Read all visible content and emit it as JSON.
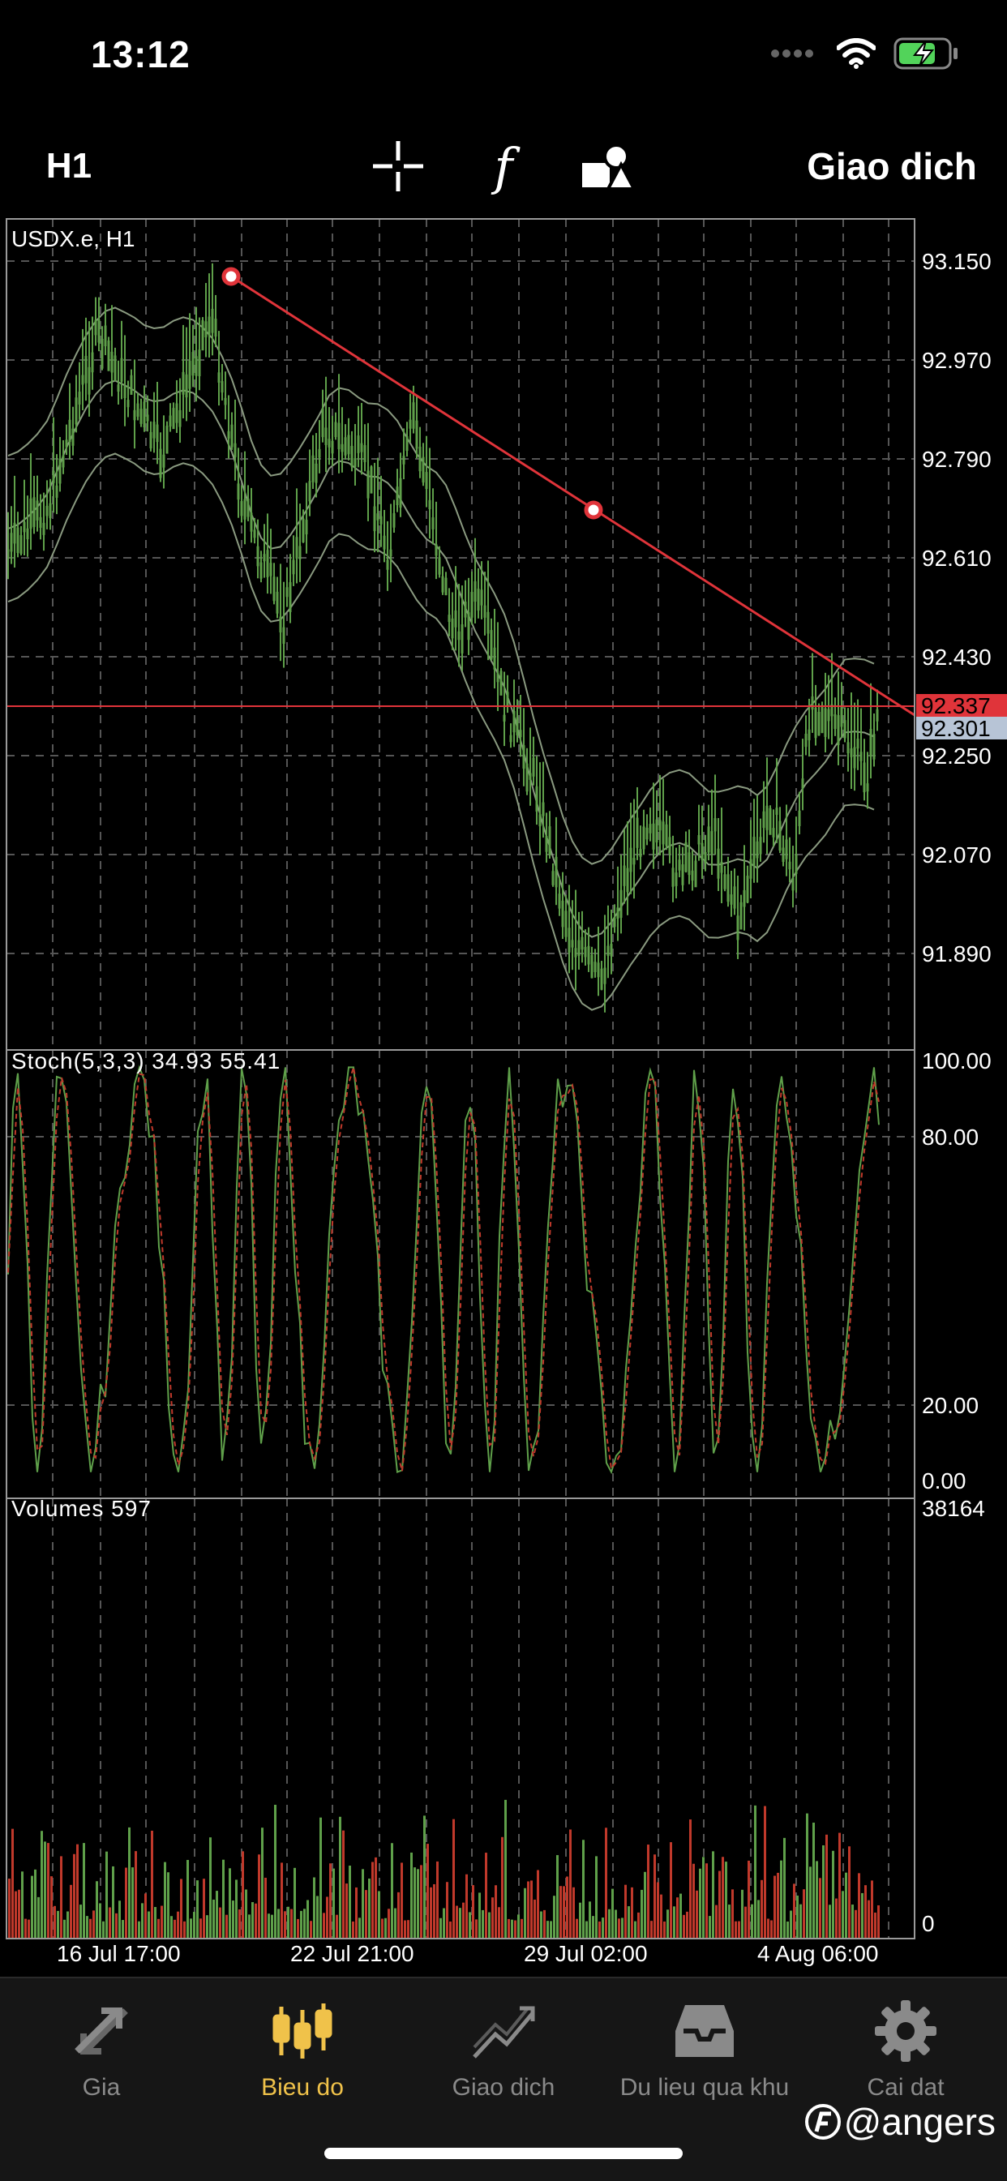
{
  "status": {
    "time": "13:12"
  },
  "toolbar": {
    "timeframe": "H1",
    "trade_label": "Giao dich",
    "function_glyph": "f"
  },
  "chart": {
    "symbol_label": "USDX.e, H1",
    "price_ticks": [
      "93.150",
      "92.970",
      "92.790",
      "92.610",
      "92.430",
      "92.250",
      "92.070",
      "91.890"
    ],
    "bid_badge": "92.337",
    "ask_badge": "92.301",
    "time_ticks": [
      "16 Jul 17:00",
      "22 Jul 21:00",
      "29 Jul 02:00",
      "4 Aug 06:00"
    ],
    "colors": {
      "bull": "#5fa04a",
      "bear": "#c0392b",
      "trendline": "#e0343a",
      "grid": "#555555",
      "ask_badge": "#b7c4d6"
    }
  },
  "stoch": {
    "label": "Stoch(5,3,3) 34.93 55.41",
    "ticks": [
      "100.00",
      "80.00",
      "20.00",
      "0.00"
    ]
  },
  "volumes": {
    "label": "Volumes 597",
    "ticks": [
      "38164",
      "0"
    ]
  },
  "tabs": [
    {
      "label": "Gia",
      "icon": "quotes-arrows-icon"
    },
    {
      "label": "Bieu do",
      "icon": "candlestick-icon"
    },
    {
      "label": "Giao dich",
      "icon": "trade-chart-icon"
    },
    {
      "label": "Du lieu qua khu",
      "icon": "history-inbox-icon"
    },
    {
      "label": "Cai dat",
      "icon": "gear-icon"
    }
  ],
  "watermark": "@angers"
}
